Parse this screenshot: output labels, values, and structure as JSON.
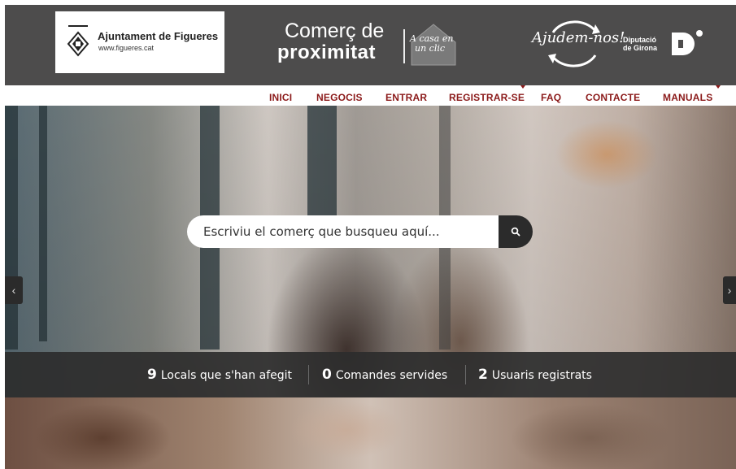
{
  "header": {
    "logo_title": "Ajuntament de Figueres",
    "logo_url": "www.figueres.cat",
    "brand_line1": "Comerç de",
    "brand_line2": "proximitat",
    "tagline_line1": "A casa en",
    "tagline_line2": "un clic",
    "campaign": "Ajudem-nos!",
    "diputacio_line1": "Diputació",
    "diputacio_line2": "de Girona",
    "background_color": "#4d4c4c"
  },
  "nav": {
    "items": [
      {
        "label": "INICI",
        "has_dropdown": false
      },
      {
        "label": "NEGOCIS",
        "has_dropdown": false
      },
      {
        "label": "ENTRAR",
        "has_dropdown": false
      },
      {
        "label": "REGISTRAR-SE",
        "has_dropdown": true
      },
      {
        "label": "FAQ",
        "has_dropdown": false
      },
      {
        "label": "CONTACTE",
        "has_dropdown": false
      },
      {
        "label": "MANUALS",
        "has_dropdown": true
      }
    ],
    "color": "#8b1a1a"
  },
  "hero": {
    "search": {
      "placeholder": "Escriviu el comerç que busqueu aquí...",
      "value": "",
      "button_icon": "search-icon"
    },
    "carousel": {
      "prev_icon": "chevron-left-icon",
      "next_icon": "chevron-right-icon",
      "prev_glyph": "‹",
      "next_glyph": "›"
    }
  },
  "stats": [
    {
      "value": "9",
      "label": "Locals que s'han afegit"
    },
    {
      "value": "0",
      "label": "Comandes servides"
    },
    {
      "value": "2",
      "label": "Usuaris registrats"
    }
  ]
}
